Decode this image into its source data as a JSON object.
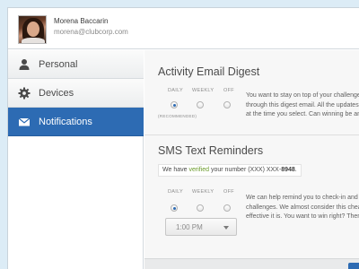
{
  "user": {
    "name": "Morena Baccarin",
    "email": "morena@clubcorp.com"
  },
  "sidebar": {
    "items": [
      {
        "label": "Personal",
        "icon": "person-icon",
        "active": false
      },
      {
        "label": "Devices",
        "icon": "gear-icon",
        "active": false
      },
      {
        "label": "Notifications",
        "icon": "envelope-icon",
        "active": true
      }
    ]
  },
  "email_digest": {
    "title": "Activity Email Digest",
    "options": [
      "DAILY",
      "WEEKLY",
      "OFF"
    ],
    "selected": "DAILY",
    "recommended_note": "(RECOMMENDED)",
    "description": [
      "You want to stay on top of your challenges, a",
      "through this digest email. All the updates, sta",
      "at the time you select. Can winning be any e"
    ]
  },
  "sms": {
    "title": "SMS Text Reminders",
    "verify_prefix": "We have",
    "verify_status": "verified",
    "verify_middle": "your number (XXX) XXX-",
    "verify_number": "8948",
    "verify_suffix": ".",
    "options": [
      "DAILY",
      "WEEKLY",
      "OFF"
    ],
    "selected": "DAILY",
    "description": [
      "We can help remind you to check-in and sta",
      "challenges. We almost consider this cheatin",
      "effective it is. You want to win right? Then try"
    ],
    "time_value": "1:00 PM"
  },
  "colors": {
    "accent": "#2d6bb3",
    "verified": "#6a9a2a",
    "background": "#dcecf6"
  }
}
